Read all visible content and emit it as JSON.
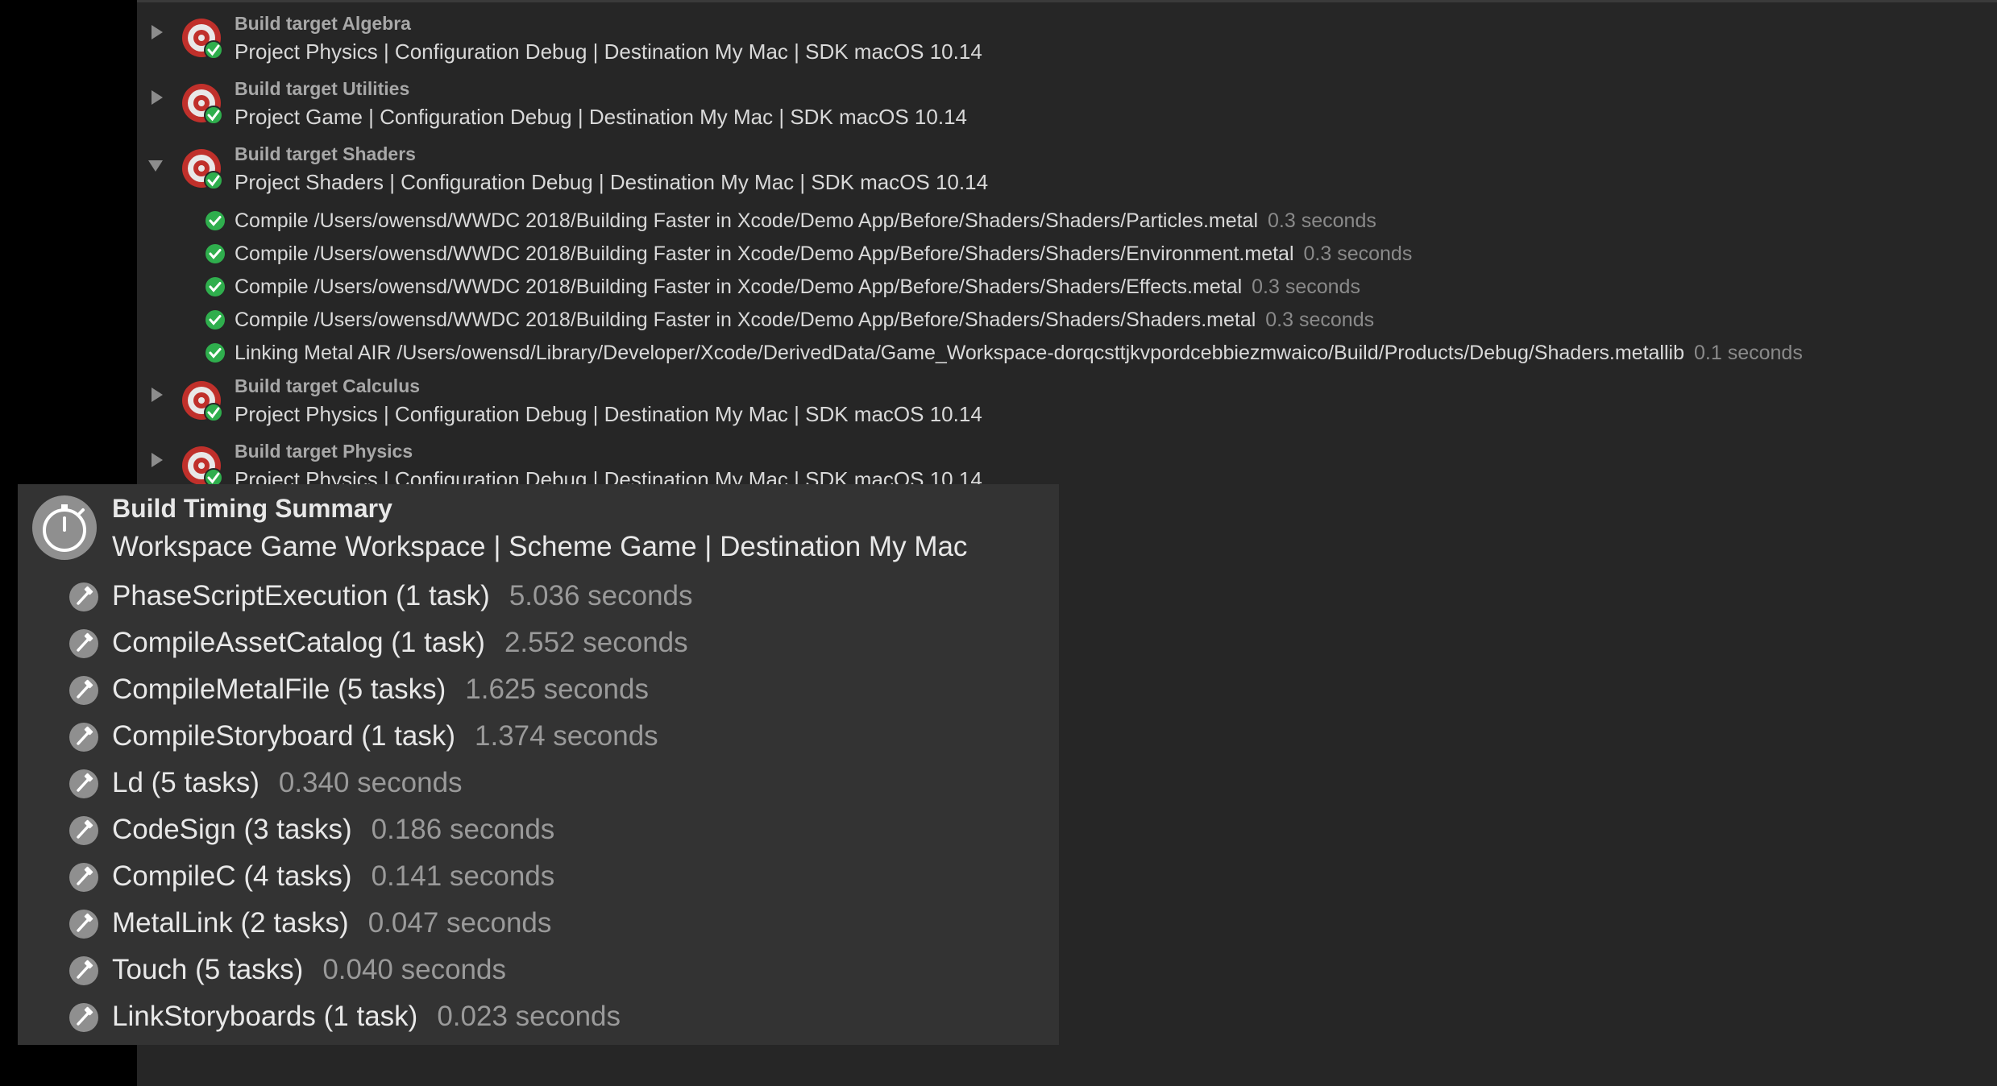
{
  "colors": {
    "background": "#000000",
    "log_panel": "#262626",
    "summary_panel": "#333333",
    "success_green": "#2fae4d",
    "target_red": "#c0302b",
    "secondary_text": "#8a8a8a"
  },
  "build_log": {
    "targets": [
      {
        "title": "Build target Algebra",
        "subtitle": "Project Physics | Configuration Debug | Destination My Mac | SDK macOS 10.14",
        "expanded": false,
        "steps": []
      },
      {
        "title": "Build target Utilities",
        "subtitle": "Project Game | Configuration Debug | Destination My Mac | SDK macOS 10.14",
        "expanded": false,
        "steps": []
      },
      {
        "title": "Build target Shaders",
        "subtitle": "Project Shaders | Configuration Debug | Destination My Mac | SDK macOS 10.14",
        "expanded": true,
        "steps": [
          {
            "text": "Compile /Users/owensd/WWDC 2018/Building Faster in Xcode/Demo App/Before/Shaders/Shaders/Particles.metal",
            "time": "0.3 seconds"
          },
          {
            "text": "Compile /Users/owensd/WWDC 2018/Building Faster in Xcode/Demo App/Before/Shaders/Shaders/Environment.metal",
            "time": "0.3 seconds"
          },
          {
            "text": "Compile /Users/owensd/WWDC 2018/Building Faster in Xcode/Demo App/Before/Shaders/Shaders/Effects.metal",
            "time": "0.3 seconds"
          },
          {
            "text": "Compile /Users/owensd/WWDC 2018/Building Faster in Xcode/Demo App/Before/Shaders/Shaders/Shaders.metal",
            "time": "0.3 seconds"
          },
          {
            "text": "Linking Metal AIR /Users/owensd/Library/Developer/Xcode/DerivedData/Game_Workspace-dorqcsttjkvpordcebbiezmwaico/Build/Products/Debug/Shaders.metallib",
            "time": "0.1 seconds"
          }
        ]
      },
      {
        "title": "Build target Calculus",
        "subtitle": "Project Physics | Configuration Debug | Destination My Mac | SDK macOS 10.14",
        "expanded": false,
        "steps": []
      },
      {
        "title": "Build target Physics",
        "subtitle": "Project Physics | Configuration Debug | Destination My Mac | SDK macOS 10.14",
        "expanded": false,
        "steps": []
      }
    ]
  },
  "timing_summary": {
    "title": "Build Timing Summary",
    "subtitle": "Workspace Game Workspace | Scheme Game | Destination My Mac",
    "icon": "stopwatch-icon",
    "tasks": [
      {
        "name": "PhaseScriptExecution (1 task)",
        "time": "5.036 seconds"
      },
      {
        "name": "CompileAssetCatalog (1 task)",
        "time": "2.552 seconds"
      },
      {
        "name": "CompileMetalFile (5 tasks)",
        "time": "1.625 seconds"
      },
      {
        "name": "CompileStoryboard (1 task)",
        "time": "1.374 seconds"
      },
      {
        "name": "Ld (5 tasks)",
        "time": "0.340 seconds"
      },
      {
        "name": "CodeSign (3 tasks)",
        "time": "0.186 seconds"
      },
      {
        "name": "CompileC (4 tasks)",
        "time": "0.141 seconds"
      },
      {
        "name": "MetalLink (2 tasks)",
        "time": "0.047 seconds"
      },
      {
        "name": "Touch (5 tasks)",
        "time": "0.040 seconds"
      },
      {
        "name": "LinkStoryboards (1 task)",
        "time": "0.023 seconds"
      }
    ]
  }
}
